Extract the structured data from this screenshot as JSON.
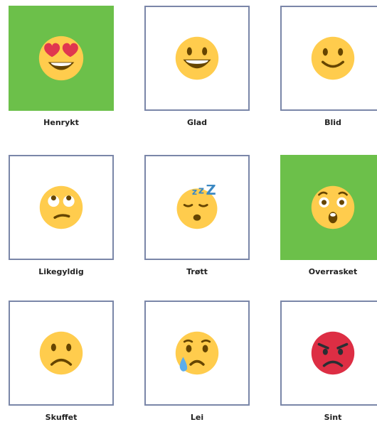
{
  "moods": [
    {
      "label": "Henrykt",
      "icon": "heart-eyes-emoji-icon",
      "selected": true
    },
    {
      "label": "Glad",
      "icon": "grinning-emoji-icon",
      "selected": false
    },
    {
      "label": "Blid",
      "icon": "slight-smile-emoji-icon",
      "selected": false
    },
    {
      "label": "Likegyldig",
      "icon": "eye-roll-emoji-icon",
      "selected": false
    },
    {
      "label": "Trøtt",
      "icon": "sleeping-emoji-icon",
      "selected": false
    },
    {
      "label": "Overrasket",
      "icon": "hushed-emoji-icon",
      "selected": true
    },
    {
      "label": "Skuffet",
      "icon": "frowning-emoji-icon",
      "selected": false
    },
    {
      "label": "Lei",
      "icon": "crying-emoji-icon",
      "selected": false
    },
    {
      "label": "Sint",
      "icon": "angry-emoji-icon",
      "selected": false
    }
  ],
  "colors": {
    "selected": "#6cc04a",
    "border": "#7a86a8",
    "face": "#ffcc4d",
    "angry_face": "#dd2e44"
  }
}
